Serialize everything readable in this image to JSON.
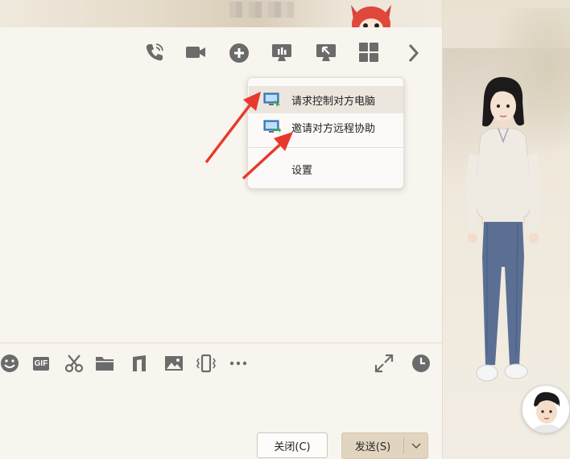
{
  "colors": {
    "icon": "#6b6b6b",
    "background": "#f8f5ef",
    "send_button": "#e2d5bf",
    "arrow": "#e8392d",
    "menu_hover": "#ebe6de"
  },
  "top_toolbar": {
    "icons": [
      "phone-icon",
      "video-camera-icon",
      "add-circle-icon",
      "screen-share-icon",
      "remote-desktop-icon",
      "apps-grid-icon",
      "chevron-right-icon"
    ]
  },
  "remote_menu": {
    "items": [
      {
        "label": "请求控制对方电脑",
        "icon": "remote-control-icon"
      },
      {
        "label": "邀请对方远程协助",
        "icon": "remote-assist-icon"
      },
      {
        "label": "设置"
      }
    ]
  },
  "input_toolbar": {
    "gif_label": "GIF",
    "icons": [
      "emoji-icon",
      "gif-icon",
      "scissors-icon",
      "folder-icon",
      "music-icon",
      "image-icon",
      "shake-icon",
      "more-icon",
      "expand-icon",
      "history-clock-icon"
    ]
  },
  "buttons": {
    "close_label": "关闭(C)",
    "send_label": "发送(S)"
  }
}
